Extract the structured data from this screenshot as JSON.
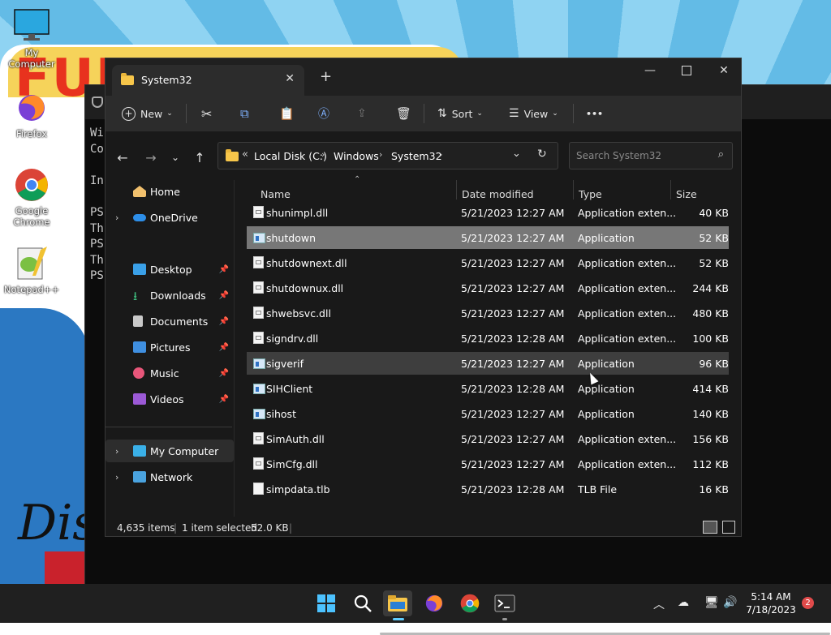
{
  "desktop": {
    "poster_text": "FULL",
    "icons": [
      {
        "label": "My Computer",
        "icon": "monitor-icon"
      },
      {
        "label": "Firefox",
        "icon": "firefox-icon"
      },
      {
        "label": "Google Chrome",
        "icon": "chrome-icon"
      },
      {
        "label": "Notepad++",
        "icon": "notepad-plus-plus-icon"
      }
    ]
  },
  "terminal": {
    "lines": [
      "Wi",
      "Co",
      "",
      "In",
      "",
      "PS",
      "Th",
      "PS",
      "Th",
      "PS"
    ]
  },
  "explorer": {
    "tab_title": "System32",
    "new_tab": "+",
    "toolbar": {
      "new_label": "New",
      "sort_label": "Sort",
      "view_label": "View",
      "more": "•••"
    },
    "breadcrumb": {
      "overflow": "«",
      "items": [
        "Local Disk (C:)",
        "Windows",
        "System32"
      ]
    },
    "search_placeholder": "Search System32",
    "sidebar": {
      "home": "Home",
      "onedrive": "OneDrive",
      "desktop": "Desktop",
      "downloads": "Downloads",
      "documents": "Documents",
      "pictures": "Pictures",
      "music": "Music",
      "videos": "Videos",
      "mycomputer": "My Computer",
      "network": "Network"
    },
    "columns": {
      "name": "Name",
      "date": "Date modified",
      "type": "Type",
      "size": "Size"
    },
    "files": [
      {
        "name": "shunimpl.dll",
        "date": "5/21/2023 12:27 AM",
        "type": "Application exten...",
        "size": "40 KB",
        "kind": "dll",
        "state": ""
      },
      {
        "name": "shutdown",
        "date": "5/21/2023 12:27 AM",
        "type": "Application",
        "size": "52 KB",
        "kind": "app",
        "state": "selected"
      },
      {
        "name": "shutdownext.dll",
        "date": "5/21/2023 12:27 AM",
        "type": "Application exten...",
        "size": "52 KB",
        "kind": "dll",
        "state": ""
      },
      {
        "name": "shutdownux.dll",
        "date": "5/21/2023 12:27 AM",
        "type": "Application exten...",
        "size": "244 KB",
        "kind": "dll",
        "state": ""
      },
      {
        "name": "shwebsvc.dll",
        "date": "5/21/2023 12:27 AM",
        "type": "Application exten...",
        "size": "480 KB",
        "kind": "dll",
        "state": ""
      },
      {
        "name": "signdrv.dll",
        "date": "5/21/2023 12:28 AM",
        "type": "Application exten...",
        "size": "100 KB",
        "kind": "dll",
        "state": ""
      },
      {
        "name": "sigverif",
        "date": "5/21/2023 12:27 AM",
        "type": "Application",
        "size": "96 KB",
        "kind": "app",
        "state": "hover"
      },
      {
        "name": "SIHClient",
        "date": "5/21/2023 12:28 AM",
        "type": "Application",
        "size": "414 KB",
        "kind": "app",
        "state": ""
      },
      {
        "name": "sihost",
        "date": "5/21/2023 12:27 AM",
        "type": "Application",
        "size": "140 KB",
        "kind": "app",
        "state": ""
      },
      {
        "name": "SimAuth.dll",
        "date": "5/21/2023 12:27 AM",
        "type": "Application exten...",
        "size": "156 KB",
        "kind": "dll",
        "state": ""
      },
      {
        "name": "SimCfg.dll",
        "date": "5/21/2023 12:27 AM",
        "type": "Application exten...",
        "size": "112 KB",
        "kind": "dll",
        "state": ""
      },
      {
        "name": "simpdata.tlb",
        "date": "5/21/2023 12:28 AM",
        "type": "TLB File",
        "size": "16 KB",
        "kind": "file",
        "state": ""
      }
    ],
    "status": {
      "items": "4,635 items",
      "selected": "1 item selected",
      "size": "52.0 KB"
    }
  },
  "taskbar": {
    "apps": [
      "start-icon",
      "search-icon",
      "file-explorer-icon",
      "firefox-icon",
      "chrome-icon",
      "terminal-icon"
    ],
    "time": "5:14 AM",
    "date": "7/18/2023",
    "notifications": "2"
  },
  "colors": {
    "accent": "#0078d4",
    "folder": "#f7c64a",
    "selected_row": "#777777"
  }
}
